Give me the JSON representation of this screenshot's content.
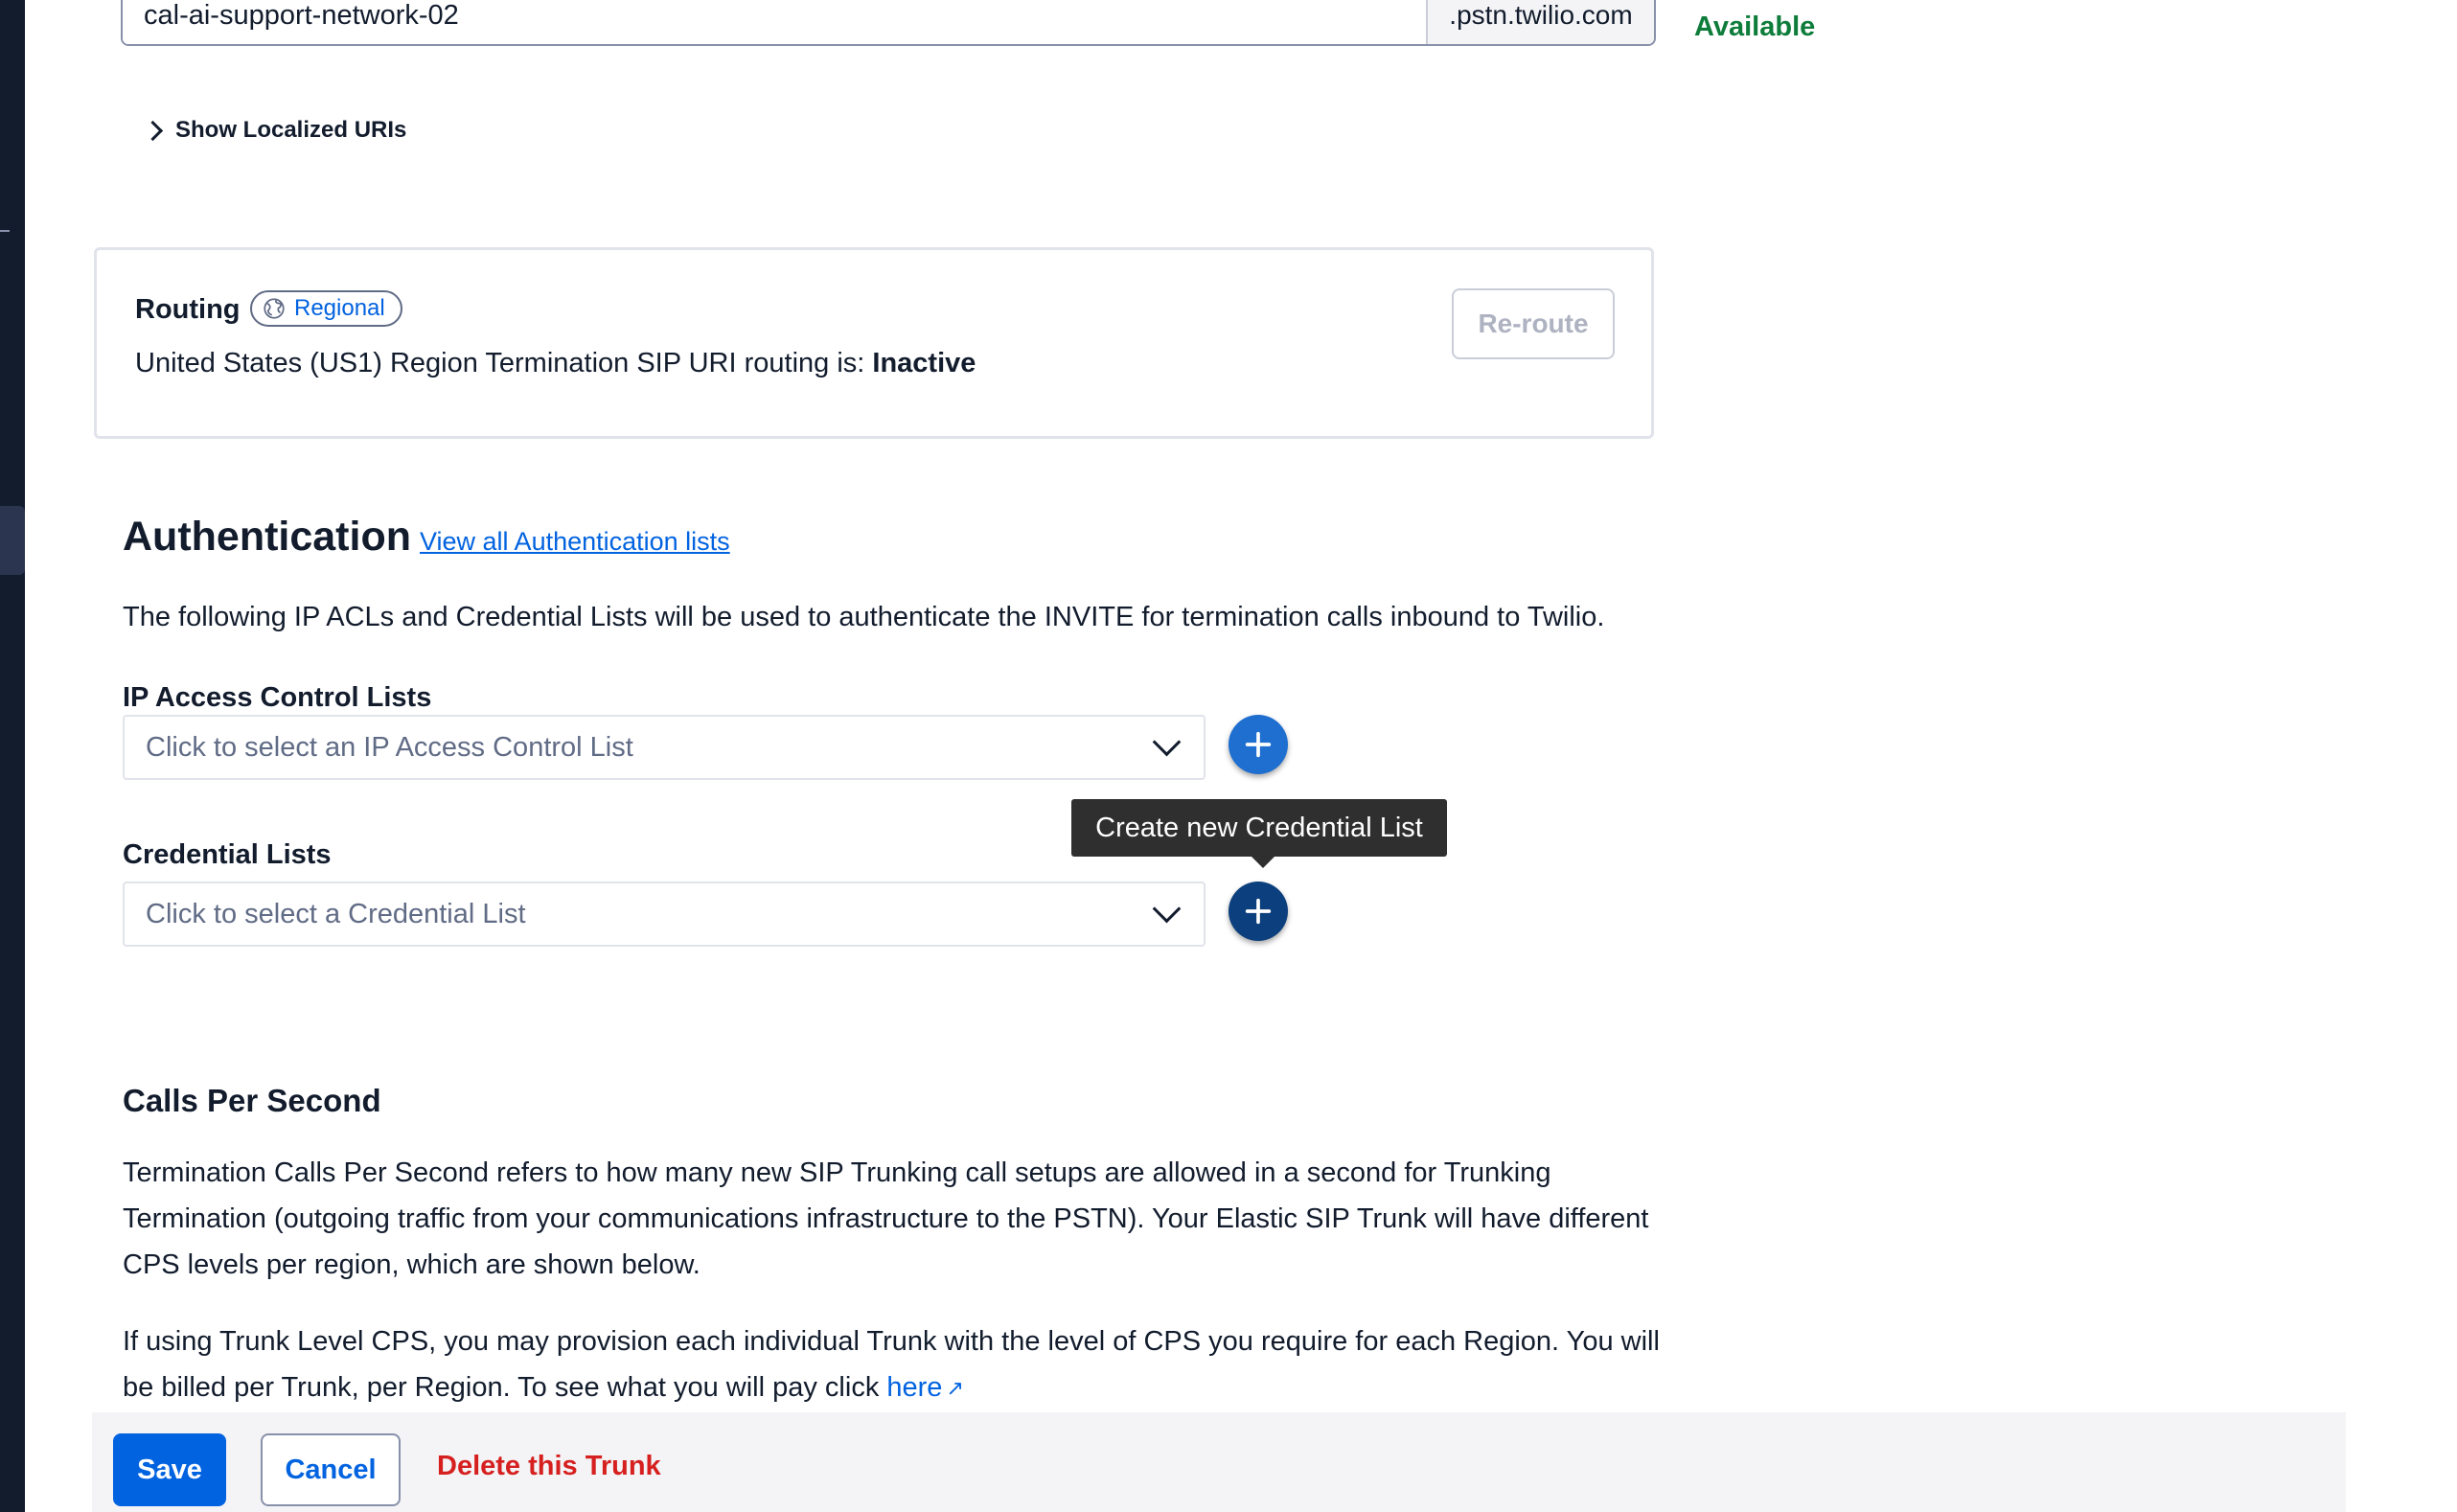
{
  "domain": {
    "value": "cal-ai-support-network-02",
    "suffix": ".pstn.twilio.com",
    "status": "Available"
  },
  "localized": {
    "label": "Show Localized URIs"
  },
  "routing": {
    "title": "Routing",
    "badge": "Regional",
    "status_prefix": "United States (US1) Region Termination SIP URI routing is:",
    "status_value": "Inactive",
    "reroute_label": "Re-route"
  },
  "auth": {
    "title": "Authentication",
    "link": "View all Authentication lists",
    "description": "The following IP ACLs and Credential Lists will be used to authenticate the INVITE for termination calls inbound to Twilio.",
    "ip_label": "IP Access Control Lists",
    "ip_placeholder": "Click to select an IP Access Control List",
    "cred_label": "Credential Lists",
    "cred_placeholder": "Click to select a Credential List",
    "tooltip": "Create new Credential List"
  },
  "cps": {
    "title": "Calls Per Second",
    "p1": "Termination Calls Per Second refers to how many new SIP Trunking call setups are allowed in a second for Trunking Termination (outgoing traffic from your communications infrastructure to the PSTN). Your Elastic SIP Trunk will have different CPS levels per region, which are shown below.",
    "p2": "If using Trunk Level CPS, you may provision each individual Trunk with the level of CPS you require for each Region. You will be billed per Trunk, per Region. To see what you will pay click",
    "link": "here"
  },
  "footer": {
    "save": "Save",
    "cancel": "Cancel",
    "delete": "Delete this Trunk"
  },
  "colors": {
    "primary": "#0263e0",
    "danger": "#d61f1f",
    "success": "#0e7c3a",
    "plus_default": "#1e6fd0",
    "plus_hover": "#0b3f7d"
  },
  "icons": {
    "globe": "globe-icon",
    "plus": "plus-icon",
    "external": "external-link-icon"
  }
}
